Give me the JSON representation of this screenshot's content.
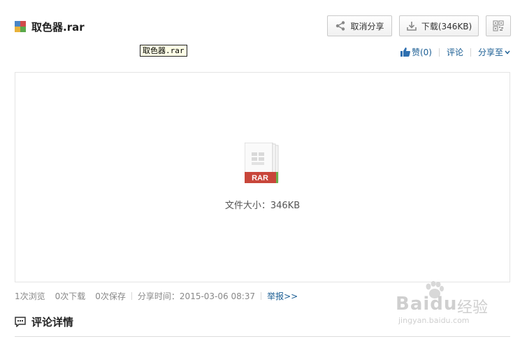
{
  "file": {
    "name": "取色器.rar",
    "tooltip": "取色器.rar"
  },
  "toolbar": {
    "unshare_label": "取消分享",
    "download_label": "下载(346KB)",
    "qr_icon": "qr-code-icon"
  },
  "social": {
    "like_label": "赞(0)",
    "comment_label": "评论",
    "share_label": "分享至"
  },
  "preview": {
    "badge": "RAR",
    "size_text": "文件大小：346KB"
  },
  "stats": {
    "views": "1次浏览",
    "downloads": "0次下载",
    "saves": "0次保存",
    "share_time": "分享时间：2015-03-06 08:37",
    "report": "举报>>"
  },
  "comments": {
    "title": "评论详情"
  },
  "watermark": {
    "brand": "Baidu",
    "product": "经验",
    "url": "jingyan.baidu.com"
  },
  "colors": {
    "accent_link": "#1a5d93",
    "rar_badge": "#c8463a",
    "border": "#e4e4e4"
  }
}
